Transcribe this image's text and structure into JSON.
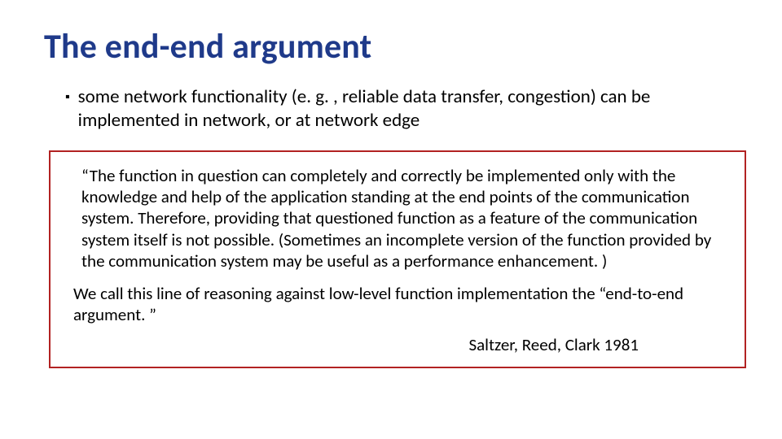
{
  "title": "The end-end argument",
  "bullet": "some network functionality (e. g. , reliable data transfer, congestion) can be implemented in network, or at network edge",
  "quote_para1": "“The function in question can completely and correctly be implemented only with the knowledge and help of the application standing at the end points of the communication system. Therefore, providing that questioned function as a feature of the communication system itself is not possible. (Sometimes an incomplete version of the function provided by the communication system may be useful as a performance enhancement. )",
  "quote_para2": "We call this line of reasoning against low-level function implementation the “end-to-end argument. ”",
  "attribution": "Saltzer, Reed, Clark 1981"
}
